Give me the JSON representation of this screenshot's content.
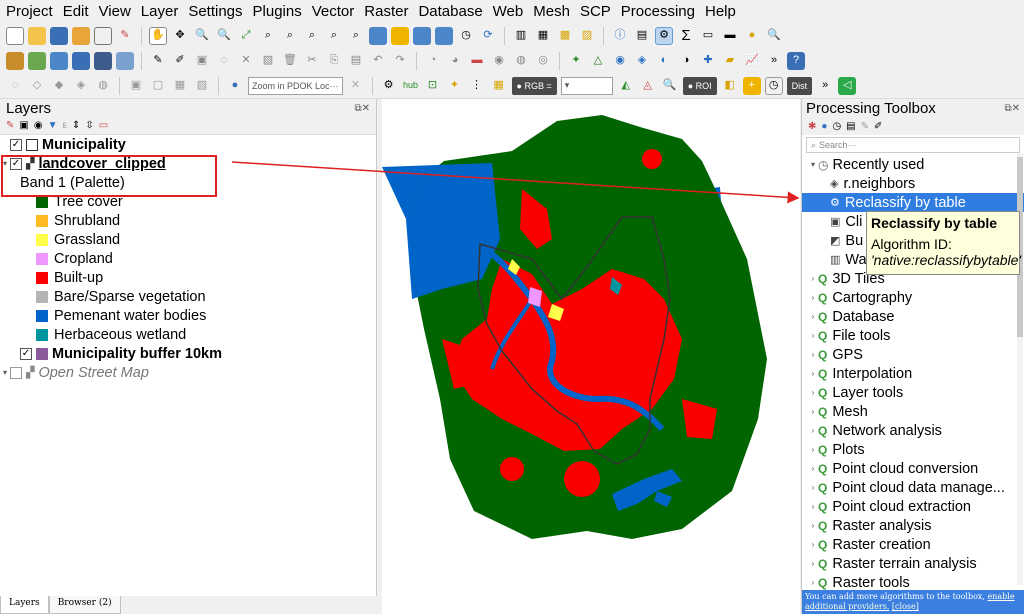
{
  "menu": [
    "Project",
    "Edit",
    "View",
    "Layer",
    "Settings",
    "Plugins",
    "Vector",
    "Raster",
    "Database",
    "Web",
    "Mesh",
    "SCP",
    "Processing",
    "Help"
  ],
  "toolbar": {
    "search_placeholder": "Zoom in PDOK Loc···",
    "rgb_label": "● RGB =",
    "roi_label": "● ROI",
    "hub_label": "hub",
    "dist_label": "Dist"
  },
  "layers_panel": {
    "title": "Layers",
    "items": [
      {
        "label": "Municipality",
        "bold": true,
        "checked": true
      },
      {
        "label": "landcover_clipped",
        "bold": true,
        "checked": true
      },
      {
        "label": "Band 1 (Palette)"
      },
      {
        "label": "Tree cover",
        "color": "#006400"
      },
      {
        "label": "Shrubland",
        "color": "#ffbb22"
      },
      {
        "label": "Grassland",
        "color": "#ffff4c"
      },
      {
        "label": "Cropland",
        "color": "#f096ff"
      },
      {
        "label": "Built-up",
        "color": "#fa0000"
      },
      {
        "label": "Bare/Sparse vegetation",
        "color": "#b4b4b4"
      },
      {
        "label": "Pemenant water bodies",
        "color": "#0064c8"
      },
      {
        "label": "Herbaceous wetland",
        "color": "#0096a0"
      },
      {
        "label": "Municipality buffer 10km",
        "bold": true,
        "checked": true,
        "color": "#8b5a9a"
      },
      {
        "label": "Open Street Map",
        "italic": true,
        "checked": false
      }
    ]
  },
  "bottom_tabs": [
    "Layers",
    "Browser (2)"
  ],
  "toolbox": {
    "title": "Processing Toolbox",
    "search_placeholder": "Search···",
    "recently_used": "Recently used",
    "recent": [
      "r.neighbors",
      "Reclassify by table",
      "Cli",
      "Bu",
      "Wa"
    ],
    "groups": [
      "3D Tiles",
      "Cartography",
      "Database",
      "File tools",
      "GPS",
      "Interpolation",
      "Layer tools",
      "Mesh",
      "Network analysis",
      "Plots",
      "Point cloud conversion",
      "Point cloud data manage...",
      "Point cloud extraction",
      "Raster analysis",
      "Raster creation",
      "Raster terrain analysis",
      "Raster tools"
    ],
    "footer_text": "You can add more algorithms to the toolbox,",
    "footer_link": "enable additional providers.",
    "footer_close": "[close]"
  },
  "tooltip": {
    "title": "Reclassify by table",
    "id_label": "Algorithm ID:",
    "id_value": "'native:reclassifybytable'"
  },
  "colors": {
    "selection": "#2f7de1",
    "annotation": "#e02020",
    "water": "#0064c8",
    "tree": "#006400",
    "builtup": "#fa0000"
  }
}
